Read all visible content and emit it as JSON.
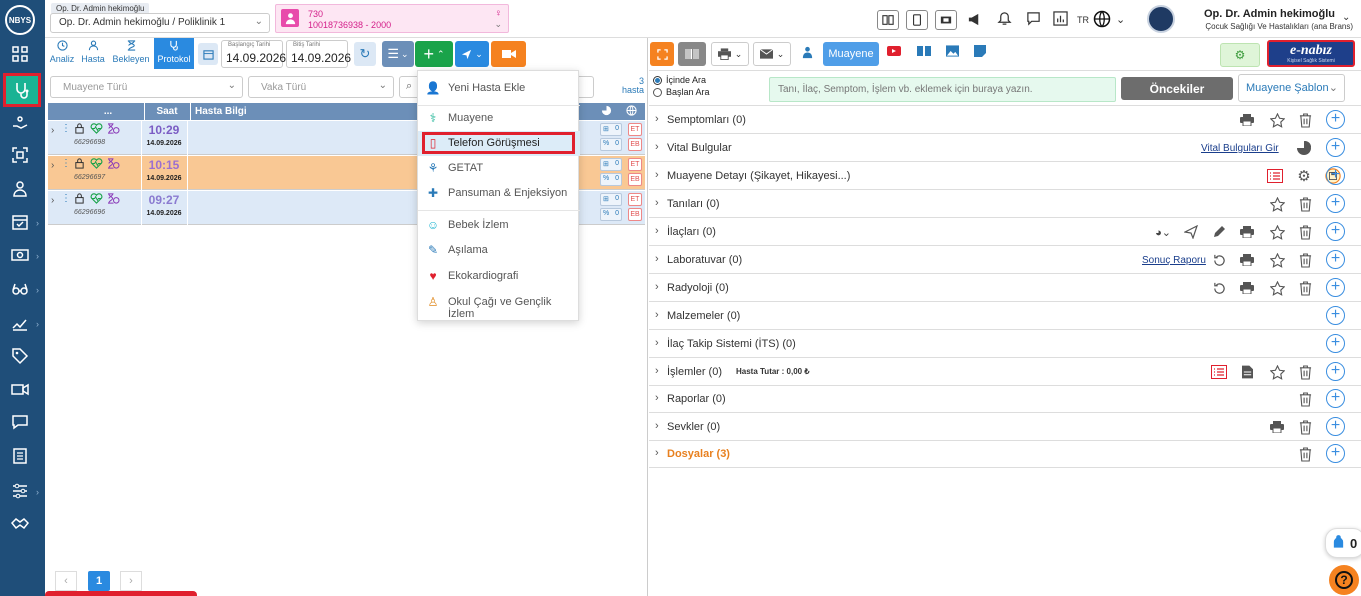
{
  "app": {
    "logo": "NBYS"
  },
  "header": {
    "role_tag": "Op. Dr. Admin hekimoğlu",
    "clinic_select": "Op. Dr. Admin hekimoğlu / Poliklinik 1",
    "patient_no": "730",
    "patient_id": "10018736938 - 2000",
    "lang": "TR",
    "user_name": "Op. Dr. Admin hekimoğlu",
    "user_dept": "Çocuk Sağlığı Ve Hastalıkları (ana Brans)"
  },
  "left_toolbar": {
    "tabs": [
      {
        "label": "Analiz",
        "icon": "clock-icon"
      },
      {
        "label": "Hasta",
        "icon": "person-icon"
      },
      {
        "label": "Bekleyen",
        "icon": "hourglass-icon"
      },
      {
        "label": "Protokol",
        "icon": "stethoscope-icon"
      }
    ],
    "start_label": "Başlangıç Tarihi",
    "start_date": "14.09.2026",
    "end_label": "Bitiş Tarihi",
    "end_date": "14.09.2026"
  },
  "filters": {
    "muayene_placeholder": "Muayene Türü",
    "vaka_placeholder": "Vaka Türü",
    "count": "3",
    "count_label": "hasta"
  },
  "table": {
    "headers": [
      "...",
      "Saat",
      "Hasta Bilgi"
    ],
    "rows": [
      {
        "id": "66296698",
        "time": "10:29",
        "date": "14.09.2026",
        "bg": "#dde9f7",
        "time_color": "#7b5cc4",
        "c1": "0",
        "c2": "0",
        "t1": "ET",
        "t2": "EB"
      },
      {
        "id": "66296697",
        "time": "10:15",
        "date": "14.09.2026",
        "bg": "#f9c894",
        "time_color": "#9b6fd0",
        "c1": "0",
        "c2": "0",
        "t1": "ET",
        "t2": "EB"
      },
      {
        "id": "66296696",
        "time": "09:27",
        "date": "14.09.2026",
        "bg": "#dde9f7",
        "time_color": "#8a7ad0",
        "c1": "0",
        "c2": "0",
        "t1": "ET",
        "t2": "EB"
      }
    ]
  },
  "pagination": {
    "prev": "‹",
    "page": "1",
    "next": "›"
  },
  "dropdown": {
    "items": [
      {
        "label": "Yeni Hasta Ekle",
        "icon": "user-plus-icon",
        "color": "#2a7ab8"
      },
      {
        "label": "Muayene",
        "icon": "stethoscope-icon",
        "color": "#1ab394"
      },
      {
        "label": "Telefon Görüşmesi",
        "icon": "phone-icon",
        "color": "#e0202e"
      },
      {
        "label": "GETAT",
        "icon": "getat-icon",
        "color": "#2a7ab8"
      },
      {
        "label": "Pansuman & Enjeksiyon",
        "icon": "bandage-icon",
        "color": "#2a7ab8"
      },
      {
        "label": "Bebek İzlem",
        "icon": "baby-icon",
        "color": "#1ab3d0"
      },
      {
        "label": "Aşılama",
        "icon": "syringe-icon",
        "color": "#2a7ab8"
      },
      {
        "label": "Ekokardiografi",
        "icon": "heart-pulse-icon",
        "color": "#e0202e"
      },
      {
        "label": "Okul Çağı ve Gençlik İzlem",
        "icon": "child-icon",
        "color": "#e08a20"
      }
    ]
  },
  "right_toolbar": {
    "muayene_tab": "Muayene",
    "enabiz": "e-nabız",
    "enabiz_sub": "Kişisel Sağlık Sistemi"
  },
  "search": {
    "option1": "İçinde Ara",
    "option2": "Başlan Ara",
    "placeholder": "Tanı, İlaç, Semptom, İşlem vb. eklemek için buraya yazın.",
    "prev_button": "Öncekiler",
    "template": "Muayene Şablon"
  },
  "sections": [
    {
      "label": "Semptomları (0)"
    },
    {
      "label": "Vital Bulgular",
      "link": "Vital Bulguları Gir"
    },
    {
      "label": "Muayene Detayı (Şikayet, Hikayesi...)"
    },
    {
      "label": "Tanıları (0)"
    },
    {
      "label": "İlaçları (0)"
    },
    {
      "label": "Laboratuvar (0)",
      "link": "Sonuç Raporu"
    },
    {
      "label": "Radyoloji (0)"
    },
    {
      "label": "Malzemeler (0)"
    },
    {
      "label": "İlaç Takip Sistemi (İTS) (0)"
    },
    {
      "label": "İşlemler (0)",
      "extra": "Hasta Tutar : 0,00 ₺"
    },
    {
      "label": "Raporlar (0)"
    },
    {
      "label": "Sevkler (0)"
    },
    {
      "label": "Dosyalar (3)",
      "orange": true
    }
  ],
  "floating": {
    "count": "0",
    "help": "?"
  },
  "colors": {
    "sidebar": "#1f4e79",
    "accent_green": "#1ab394",
    "accent_orange": "#f58220",
    "highlight_red": "#e0202e"
  }
}
